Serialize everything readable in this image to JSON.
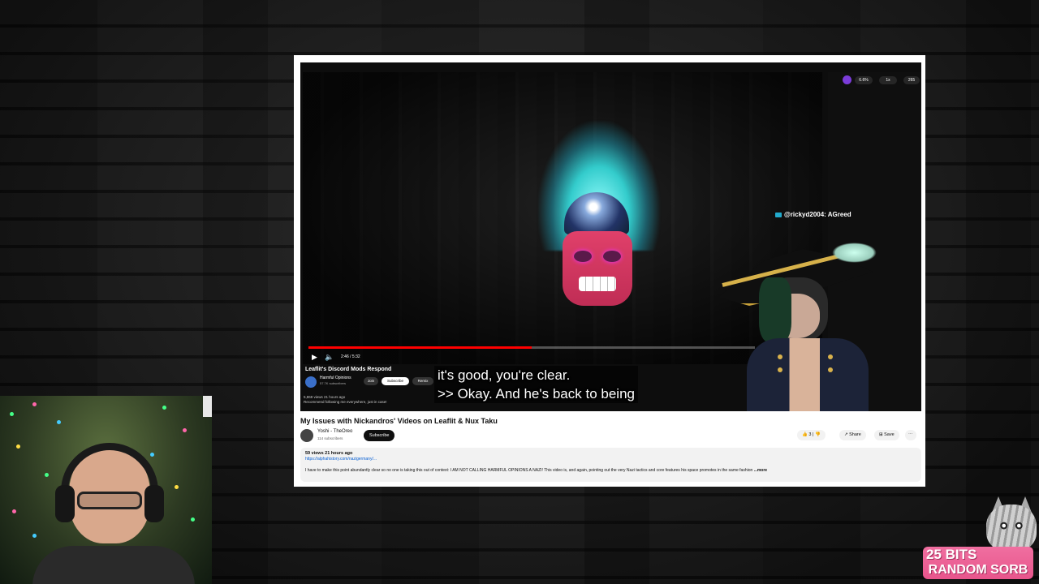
{
  "stream_overlay": {
    "alert_line1": "25 BITS",
    "alert_line2": "RANDOM SORB",
    "alert_color": "#e8558c"
  },
  "inner_video": {
    "title": "Leaflit's Discord Mods Respond",
    "channel": "Harmful Opinions",
    "subscribers": "57.7K subscribers",
    "join_label": "Join",
    "subscribe_label": "Subscribe",
    "other_button": "Remix",
    "stats": "5,869 views  21 hours ago",
    "stats_line2": "Recommend following me everywhere, just in case!",
    "time": "2:46 / 5:32",
    "progress_fraction": 0.5,
    "side_controls": [
      "6.6%",
      "1x",
      "265"
    ]
  },
  "captions": {
    "line1": "it's good, you're clear.",
    "line2": ">> Okay. And he's back to being"
  },
  "chat_message": "@rickyd2004: AGreed",
  "page": {
    "title": "My Issues with Nickandros' Videos on Leaflit & Nux Taku",
    "channel_name": "Yoshi - TheOreo",
    "channel_subs": "114 subscribers",
    "subscribe_label": "Subscribe",
    "likes": "3",
    "share_label": "Share",
    "save_label": "Save",
    "more_icon": "⋯"
  },
  "description": {
    "views": "59 views  21 hours ago",
    "link": "https://alphahistory.com/nazigermany/...",
    "text": "I have to make this point abundantly clear so no one is taking this out of context: I AM NOT CALLING HARMFUL OPINIONS A NAZI! This video is, and again, pointing out the very Nazi tactics and core features his space promotes in the same fashion",
    "more_label": "...more"
  }
}
